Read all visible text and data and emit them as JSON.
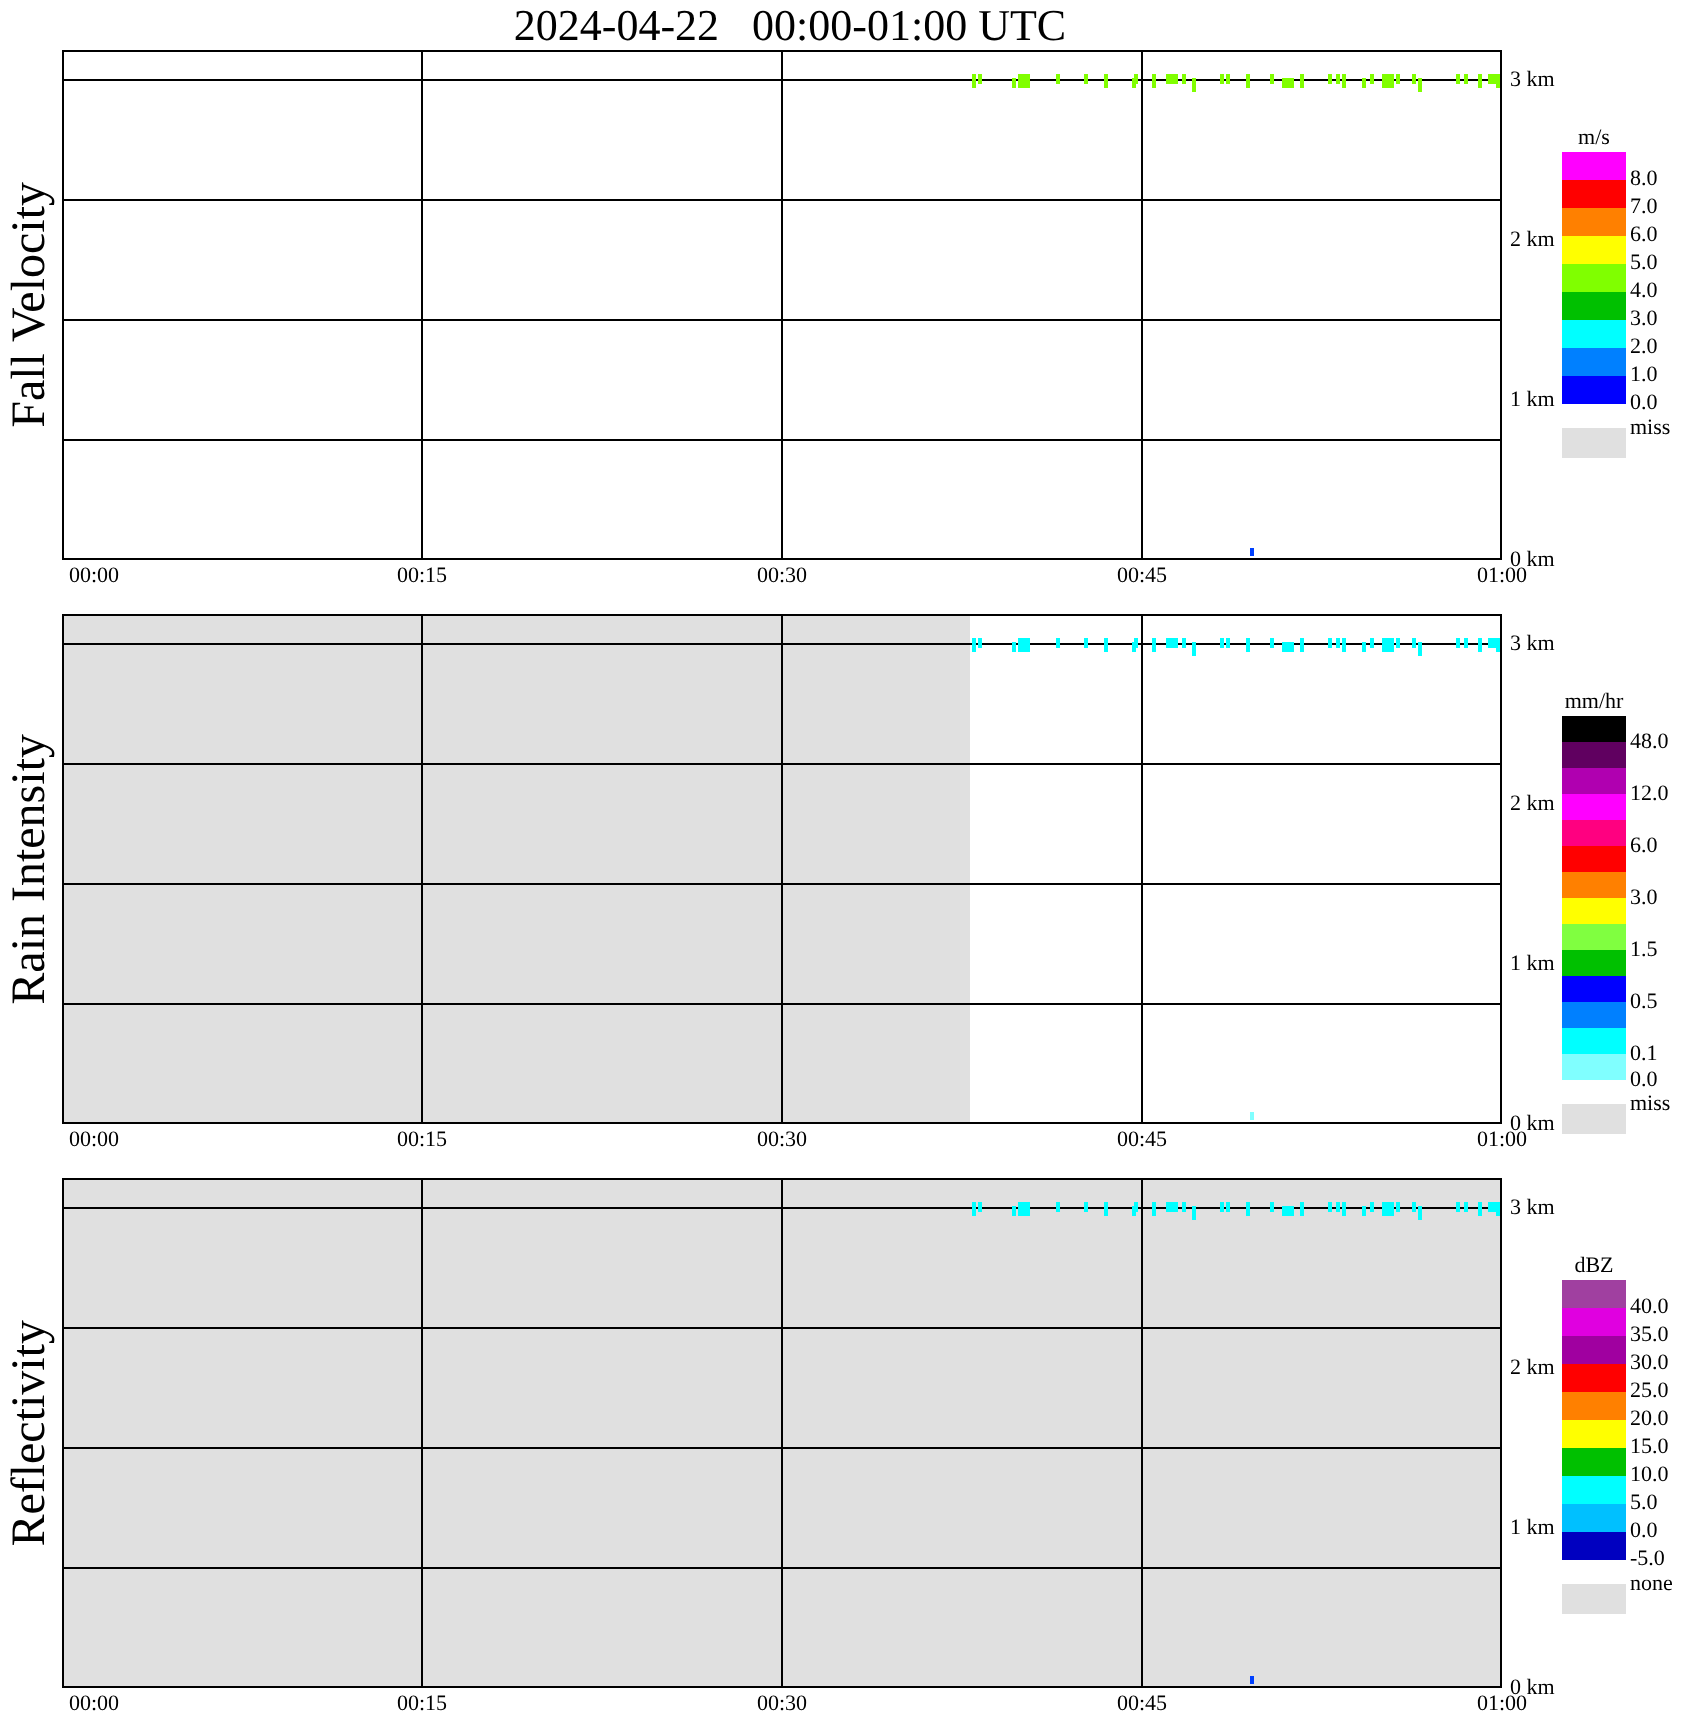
{
  "title": "2024-04-22   00:00-01:00 UTC",
  "panels": [
    {
      "title": "Fall Velocity",
      "kind": "velocity",
      "x_ticks": [
        "00:00",
        "00:15",
        "00:30",
        "00:45",
        "01:00"
      ],
      "y_ticks": [
        "3 km",
        "2 km",
        "1 km",
        "0 km"
      ],
      "legend": {
        "unit": "m/s",
        "bands": [
          {
            "color": "#ff00ff",
            "label": "8.0"
          },
          {
            "color": "#ff0000",
            "label": "7.0"
          },
          {
            "color": "#ff8000",
            "label": "6.0"
          },
          {
            "color": "#ffff00",
            "label": "5.0"
          },
          {
            "color": "#80ff00",
            "label": "4.0"
          },
          {
            "color": "#00c000",
            "label": "3.0"
          },
          {
            "color": "#00ffff",
            "label": "2.0"
          },
          {
            "color": "#0080ff",
            "label": "1.0"
          },
          {
            "color": "#0000ff",
            "label": "0.0"
          }
        ],
        "missing_label": "miss"
      }
    },
    {
      "title": "Rain Intensity",
      "kind": "rain",
      "x_ticks": [
        "00:00",
        "00:15",
        "00:30",
        "00:45",
        "01:00"
      ],
      "y_ticks": [
        "3 km",
        "2 km",
        "1 km",
        "0 km"
      ],
      "legend": {
        "unit": "mm/hr",
        "bands": [
          {
            "color": "#000000",
            "label": "48.0"
          },
          {
            "color": "#600060"
          },
          {
            "color": "#b000b0",
            "label": "12.0"
          },
          {
            "color": "#ff00ff"
          },
          {
            "color": "#ff0080",
            "label": "6.0"
          },
          {
            "color": "#ff0000"
          },
          {
            "color": "#ff8000",
            "label": "3.0"
          },
          {
            "color": "#ffff00"
          },
          {
            "color": "#80ff40",
            "label": "1.5"
          },
          {
            "color": "#00c000"
          },
          {
            "color": "#0000ff",
            "label": "0.5"
          },
          {
            "color": "#0080ff"
          },
          {
            "color": "#00ffff",
            "label": "0.1"
          },
          {
            "color": "#80ffff",
            "label": "0.0"
          }
        ],
        "missing_label": "miss"
      }
    },
    {
      "title": "Reflectivity",
      "kind": "reflectivity",
      "x_ticks": [
        "00:00",
        "00:15",
        "00:30",
        "00:45",
        "01:00"
      ],
      "y_ticks": [
        "3 km",
        "2 km",
        "1 km",
        "0 km"
      ],
      "legend": {
        "unit": "dBZ",
        "bands": [
          {
            "color": "#a040a0",
            "label": "40.0"
          },
          {
            "color": "#e000e0",
            "label": "35.0"
          },
          {
            "color": "#a000a0",
            "label": "30.0"
          },
          {
            "color": "#ff0000",
            "label": "25.0"
          },
          {
            "color": "#ff8000",
            "label": "20.0"
          },
          {
            "color": "#ffff00",
            "label": "15.0"
          },
          {
            "color": "#00c000",
            "label": "10.0"
          },
          {
            "color": "#00ffff",
            "label": "5.0"
          },
          {
            "color": "#00c0ff",
            "label": "0.0"
          },
          {
            "color": "#0000c0",
            "label": "-5.0"
          }
        ],
        "missing_label": "none"
      }
    }
  ]
}
